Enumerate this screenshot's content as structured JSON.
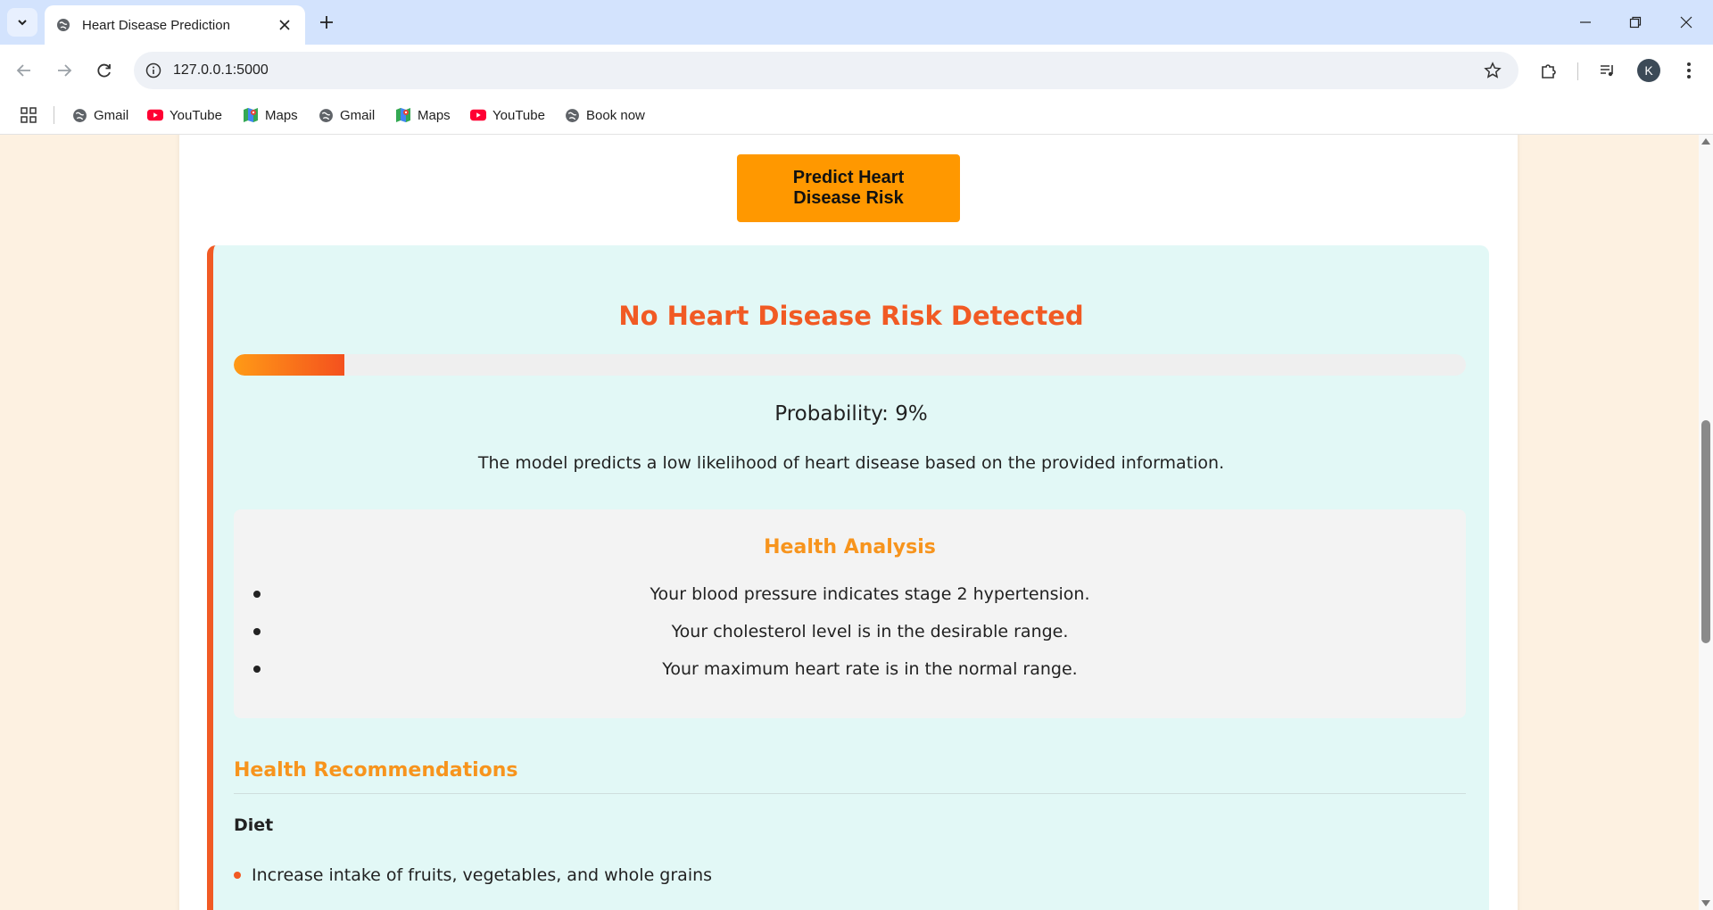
{
  "browser": {
    "tab_title": "Heart Disease Prediction",
    "url": "127.0.0.1:5000",
    "avatar_letter": "K",
    "bookmarks": [
      {
        "label": "Gmail",
        "icon": "globe-icon"
      },
      {
        "label": "YouTube",
        "icon": "youtube-icon"
      },
      {
        "label": "Maps",
        "icon": "maps-icon"
      },
      {
        "label": "Gmail",
        "icon": "globe-icon"
      },
      {
        "label": "Maps",
        "icon": "maps-icon"
      },
      {
        "label": "YouTube",
        "icon": "youtube-icon"
      },
      {
        "label": "Book now",
        "icon": "globe-icon"
      }
    ]
  },
  "page": {
    "predict_button": "Predict Heart Disease Risk",
    "result": {
      "title": "No Heart Disease Risk Detected",
      "probability_percent": 9,
      "probability_text": "Probability: 9%",
      "description": "The model predicts a low likelihood of heart disease based on the provided information."
    },
    "analysis": {
      "title": "Health Analysis",
      "items": [
        "Your blood pressure indicates stage 2 hypertension.",
        "Your cholesterol level is in the desirable range.",
        "Your maximum heart rate is in the normal range."
      ]
    },
    "recommendations": {
      "title": "Health Recommendations",
      "diet_heading": "Diet",
      "diet_items": [
        "Increase intake of fruits, vegetables, and whole grains"
      ]
    }
  },
  "colors": {
    "accent_orange": "#ff9800",
    "result_red": "#f15a24",
    "heading_orange": "#f7941d",
    "result_bg": "#e2f8f6",
    "page_bg": "#fdf1e1"
  }
}
